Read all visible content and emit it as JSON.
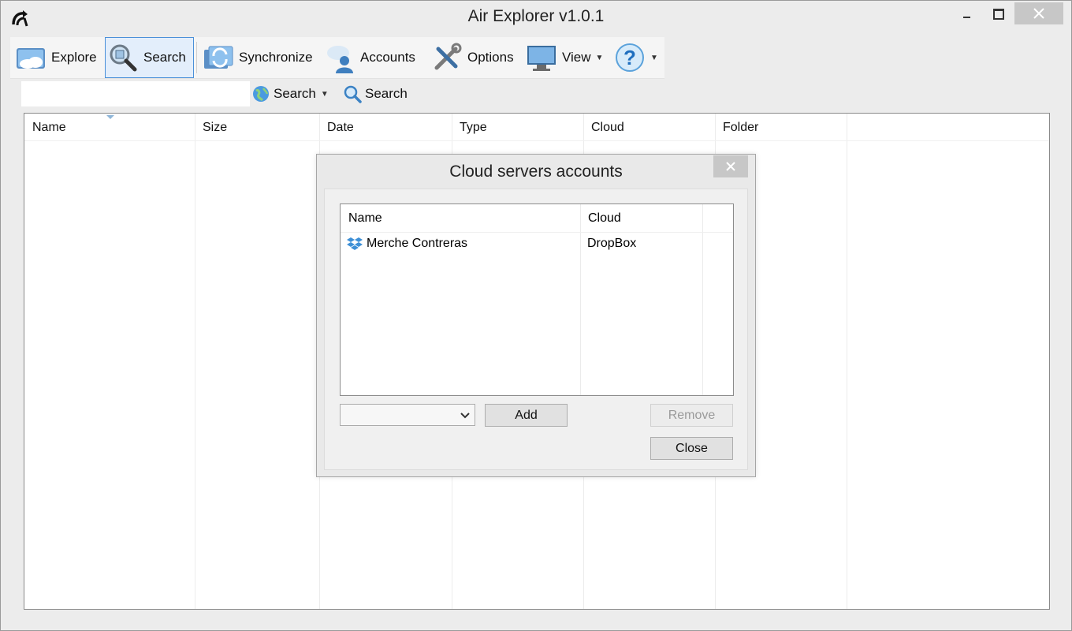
{
  "window": {
    "title": "Air Explorer v1.0.1"
  },
  "toolbar": {
    "explore": "Explore",
    "search": "Search",
    "synchronize": "Synchronize",
    "accounts": "Accounts",
    "options": "Options",
    "view": "View",
    "help_icon": "help-icon"
  },
  "searchbar": {
    "value": "",
    "scope_label": "Search",
    "search_button": "Search"
  },
  "filelist": {
    "columns": [
      "Name",
      "Size",
      "Date",
      "Type",
      "Cloud",
      "Folder"
    ],
    "rows": []
  },
  "dialog": {
    "title": "Cloud servers accounts",
    "columns": [
      "Name",
      "Cloud"
    ],
    "rows": [
      {
        "name": "Merche Contreras",
        "cloud": "DropBox",
        "icon": "dropbox-icon"
      }
    ],
    "select_value": "",
    "add": "Add",
    "remove": "Remove",
    "close": "Close"
  },
  "colors": {
    "accent": "#4a90d9",
    "close_button": "#c7c7c7"
  }
}
